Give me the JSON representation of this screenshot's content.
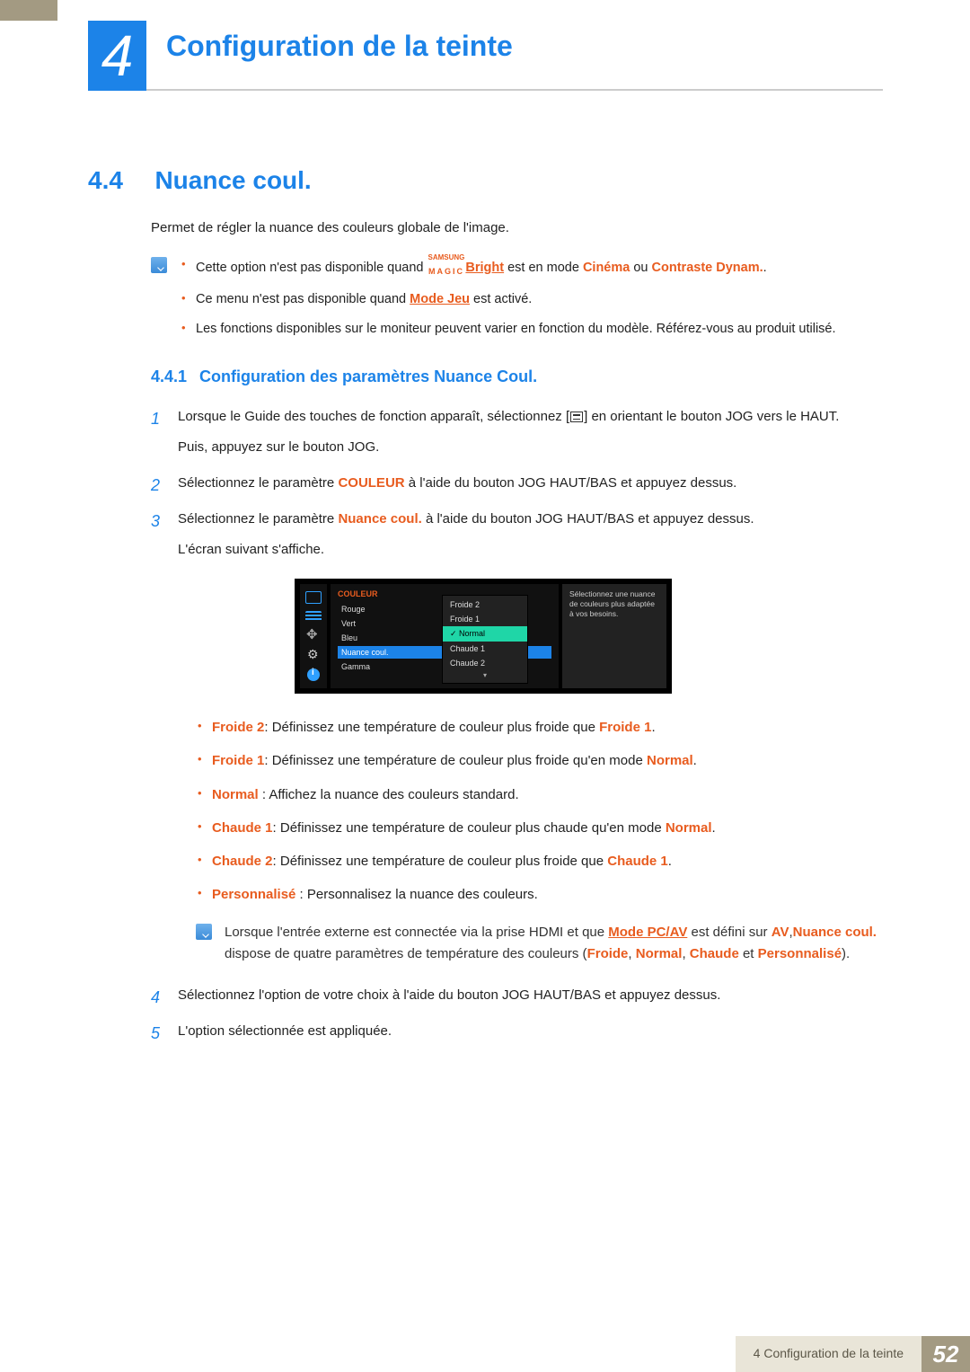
{
  "chapter": {
    "number": "4",
    "title": "Configuration de la teinte"
  },
  "section": {
    "number": "4.4",
    "title": "Nuance coul."
  },
  "intro": "Permet de régler la nuance des couleurs globale de l'image.",
  "note1": {
    "items": [
      {
        "pre": "Cette option n'est pas disponible quand ",
        "magic_top": "SAMSUNG",
        "magic_bottom": "MAGIC",
        "magic_word": "Bright",
        "mid": " est en mode ",
        "kw1": "Cinéma",
        "mid2": " ou ",
        "kw2": "Contraste Dynam.",
        "post": "."
      },
      {
        "pre": "Ce menu n'est pas disponible quand ",
        "kw1": "Mode Jeu",
        "post": " est activé."
      },
      {
        "plain": "Les fonctions disponibles sur le moniteur peuvent varier en fonction du modèle. Référez-vous au produit utilisé."
      }
    ]
  },
  "subsection": {
    "number": "4.4.1",
    "title": "Configuration des paramètres Nuance Coul."
  },
  "steps": {
    "s1a": "Lorsque le Guide des touches de fonction apparaît, sélectionnez [",
    "s1b": "] en orientant le bouton JOG vers le HAUT.",
    "s1c": "Puis, appuyez sur le bouton JOG.",
    "s2a": "Sélectionnez le paramètre ",
    "s2kw": "COULEUR",
    "s2b": " à l'aide du bouton JOG HAUT/BAS et appuyez dessus.",
    "s3a": "Sélectionnez le paramètre ",
    "s3kw": "Nuance coul.",
    "s3b": " à l'aide du bouton JOG HAUT/BAS et appuyez dessus.",
    "s3c": "L'écran suivant s'affiche.",
    "s4": "Sélectionnez l'option de votre choix à l'aide du bouton JOG HAUT/BAS et appuyez dessus.",
    "s5": "L'option sélectionnée est appliquée."
  },
  "osd": {
    "menu_title": "COULEUR",
    "rows": [
      "Rouge",
      "Vert",
      "Bleu",
      "Nuance coul.",
      "Gamma"
    ],
    "selected_row_index": 3,
    "popup": [
      "Froide 2",
      "Froide 1",
      "Normal",
      "Chaude 1",
      "Chaude 2"
    ],
    "popup_selected_index": 2,
    "help": "Sélectionnez une nuance de couleurs plus adaptée à vos besoins."
  },
  "descriptions": [
    {
      "kw": "Froide 2",
      "sep": ": ",
      "text": "Définissez une température de couleur plus froide que ",
      "kw2": "Froide 1",
      "post": "."
    },
    {
      "kw": "Froide 1",
      "sep": ": ",
      "text": "Définissez une température de couleur plus froide qu'en mode ",
      "kw2": "Normal",
      "post": "."
    },
    {
      "kw": "Normal",
      "sep": " : ",
      "text": "Affichez la nuance des couleurs standard."
    },
    {
      "kw": "Chaude 1",
      "sep": ": ",
      "text": "Définissez une température de couleur plus chaude qu'en mode ",
      "kw2": "Normal",
      "post": "."
    },
    {
      "kw": "Chaude 2",
      "sep": ": ",
      "text": "Définissez une température de couleur plus froide que ",
      "kw2": "Chaude 1",
      "post": "."
    },
    {
      "kw": "Personnalisé",
      "sep": " : ",
      "text": "Personnalisez la nuance des couleurs."
    }
  ],
  "note2": {
    "pre": "Lorsque l'entrée externe est connectée via la prise HDMI et que ",
    "kw1": "Mode PC/AV",
    "mid1": " est défini sur ",
    "kw2": "AV",
    "mid2": ",",
    "kw3": "Nuance coul.",
    "mid3": " dispose de quatre paramètres de température des couleurs (",
    "kw4": "Froide",
    "c1": ", ",
    "kw5": "Normal",
    "c2": ", ",
    "kw6": "Chaude",
    "mid4": " et ",
    "kw7": "Personnalisé",
    "post": ")."
  },
  "footer": {
    "title": "4 Configuration de la teinte",
    "page": "52"
  }
}
